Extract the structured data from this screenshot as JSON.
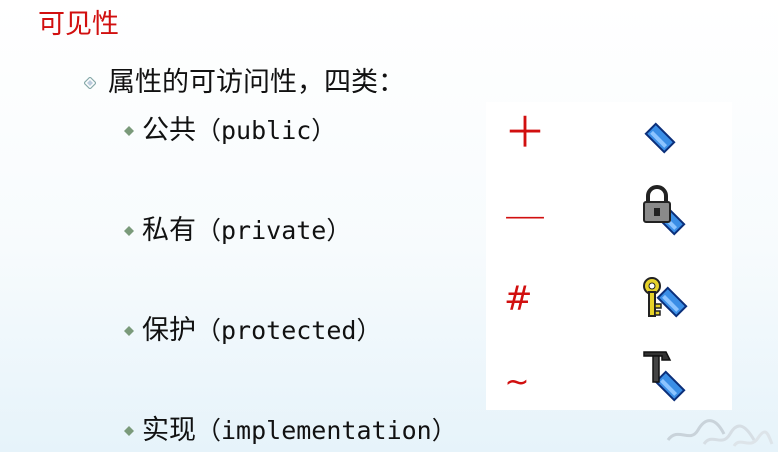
{
  "heading": "可见性",
  "bullet": {
    "text": "属性的可访问性，四类："
  },
  "items": [
    {
      "cn": "公共",
      "en": "（public）",
      "symbol": "＋",
      "icon": "public-diamond-icon"
    },
    {
      "cn": "私有",
      "en": "（private）",
      "symbol": "—",
      "icon": "private-lock-icon"
    },
    {
      "cn": "保护",
      "en": "（protected）",
      "symbol": "#",
      "icon": "protected-key-icon"
    },
    {
      "cn": "实现",
      "en": "（implementation）",
      "symbol": "~",
      "icon": "implementation-hammer-icon"
    }
  ],
  "colors": {
    "heading": "#d10f0f",
    "symbol": "#d10f0f",
    "diamond_fill": "#3a8ee6",
    "diamond_stroke": "#0b2f7a"
  }
}
